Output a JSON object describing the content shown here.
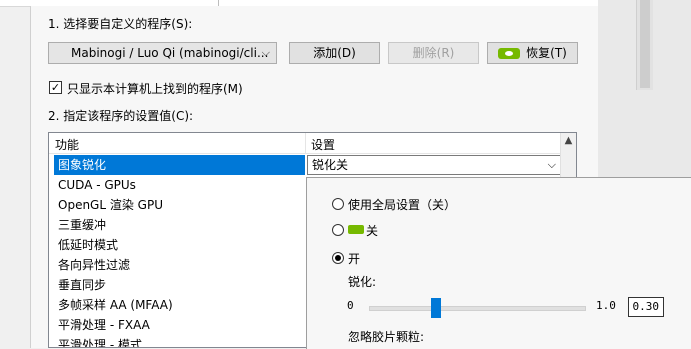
{
  "section1": {
    "label": "1. 选择要自定义的程序(S):"
  },
  "program_select": {
    "value": "Mabinogi / Luo Qi (mabinogi/cli..."
  },
  "buttons": {
    "add": "添加(D)",
    "remove": "删除(R)",
    "restore": "恢复(T)"
  },
  "checkbox": {
    "label": "只显示本计算机上找到的程序(M)",
    "checked": "✓"
  },
  "section2": {
    "label": "2. 指定该程序的设置值(C):"
  },
  "table": {
    "headers": {
      "feature": "功能",
      "setting": "设置"
    },
    "rows": [
      {
        "label": "图象锐化"
      },
      {
        "label": "CUDA - GPUs"
      },
      {
        "label": "OpenGL 渲染 GPU"
      },
      {
        "label": "三重缓冲"
      },
      {
        "label": "低延时模式"
      },
      {
        "label": "各向异性过滤"
      },
      {
        "label": "垂直同步"
      },
      {
        "label": "多帧采样 AA (MFAA)"
      },
      {
        "label": "平滑处理 - FXAA"
      },
      {
        "label": "平滑处理 - 模式"
      }
    ],
    "selected_setting": "锐化关"
  },
  "popup": {
    "option_global": "使用全局设置（关）",
    "option_off": "关",
    "option_on": "开",
    "sharpen_label": "锐化:",
    "slider_min": "0",
    "slider_max": "1.0",
    "slider_value": "0.30",
    "ignore_grain_label": "忽略胶片颗粒:"
  },
  "colors": {
    "selection": "#0078d7",
    "nvidia_green": "#76b900"
  }
}
